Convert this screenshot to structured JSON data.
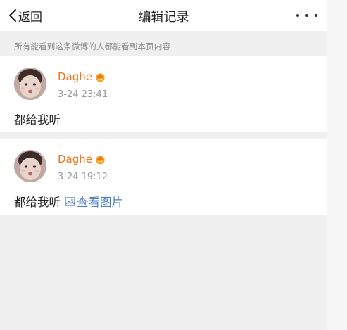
{
  "nav": {
    "back_label": "返回",
    "title": "编辑记录"
  },
  "notice": "所有能看到这条微博的人都能看到本页内容",
  "records": [
    {
      "username": "Daghe",
      "time": "3-24 23:41",
      "text": "都给我听"
    },
    {
      "username": "Daghe",
      "time": "3-24 19:12",
      "text": "都给我听",
      "link_label": "查看图片"
    }
  ],
  "colors": {
    "username": "#e8761d",
    "link": "#4c7ec2",
    "badge": "#f5a623"
  },
  "icons": {
    "back": "chevron-left-icon",
    "more": "more-horizontal-icon",
    "badge": "vip-crown-icon",
    "image": "image-icon"
  }
}
